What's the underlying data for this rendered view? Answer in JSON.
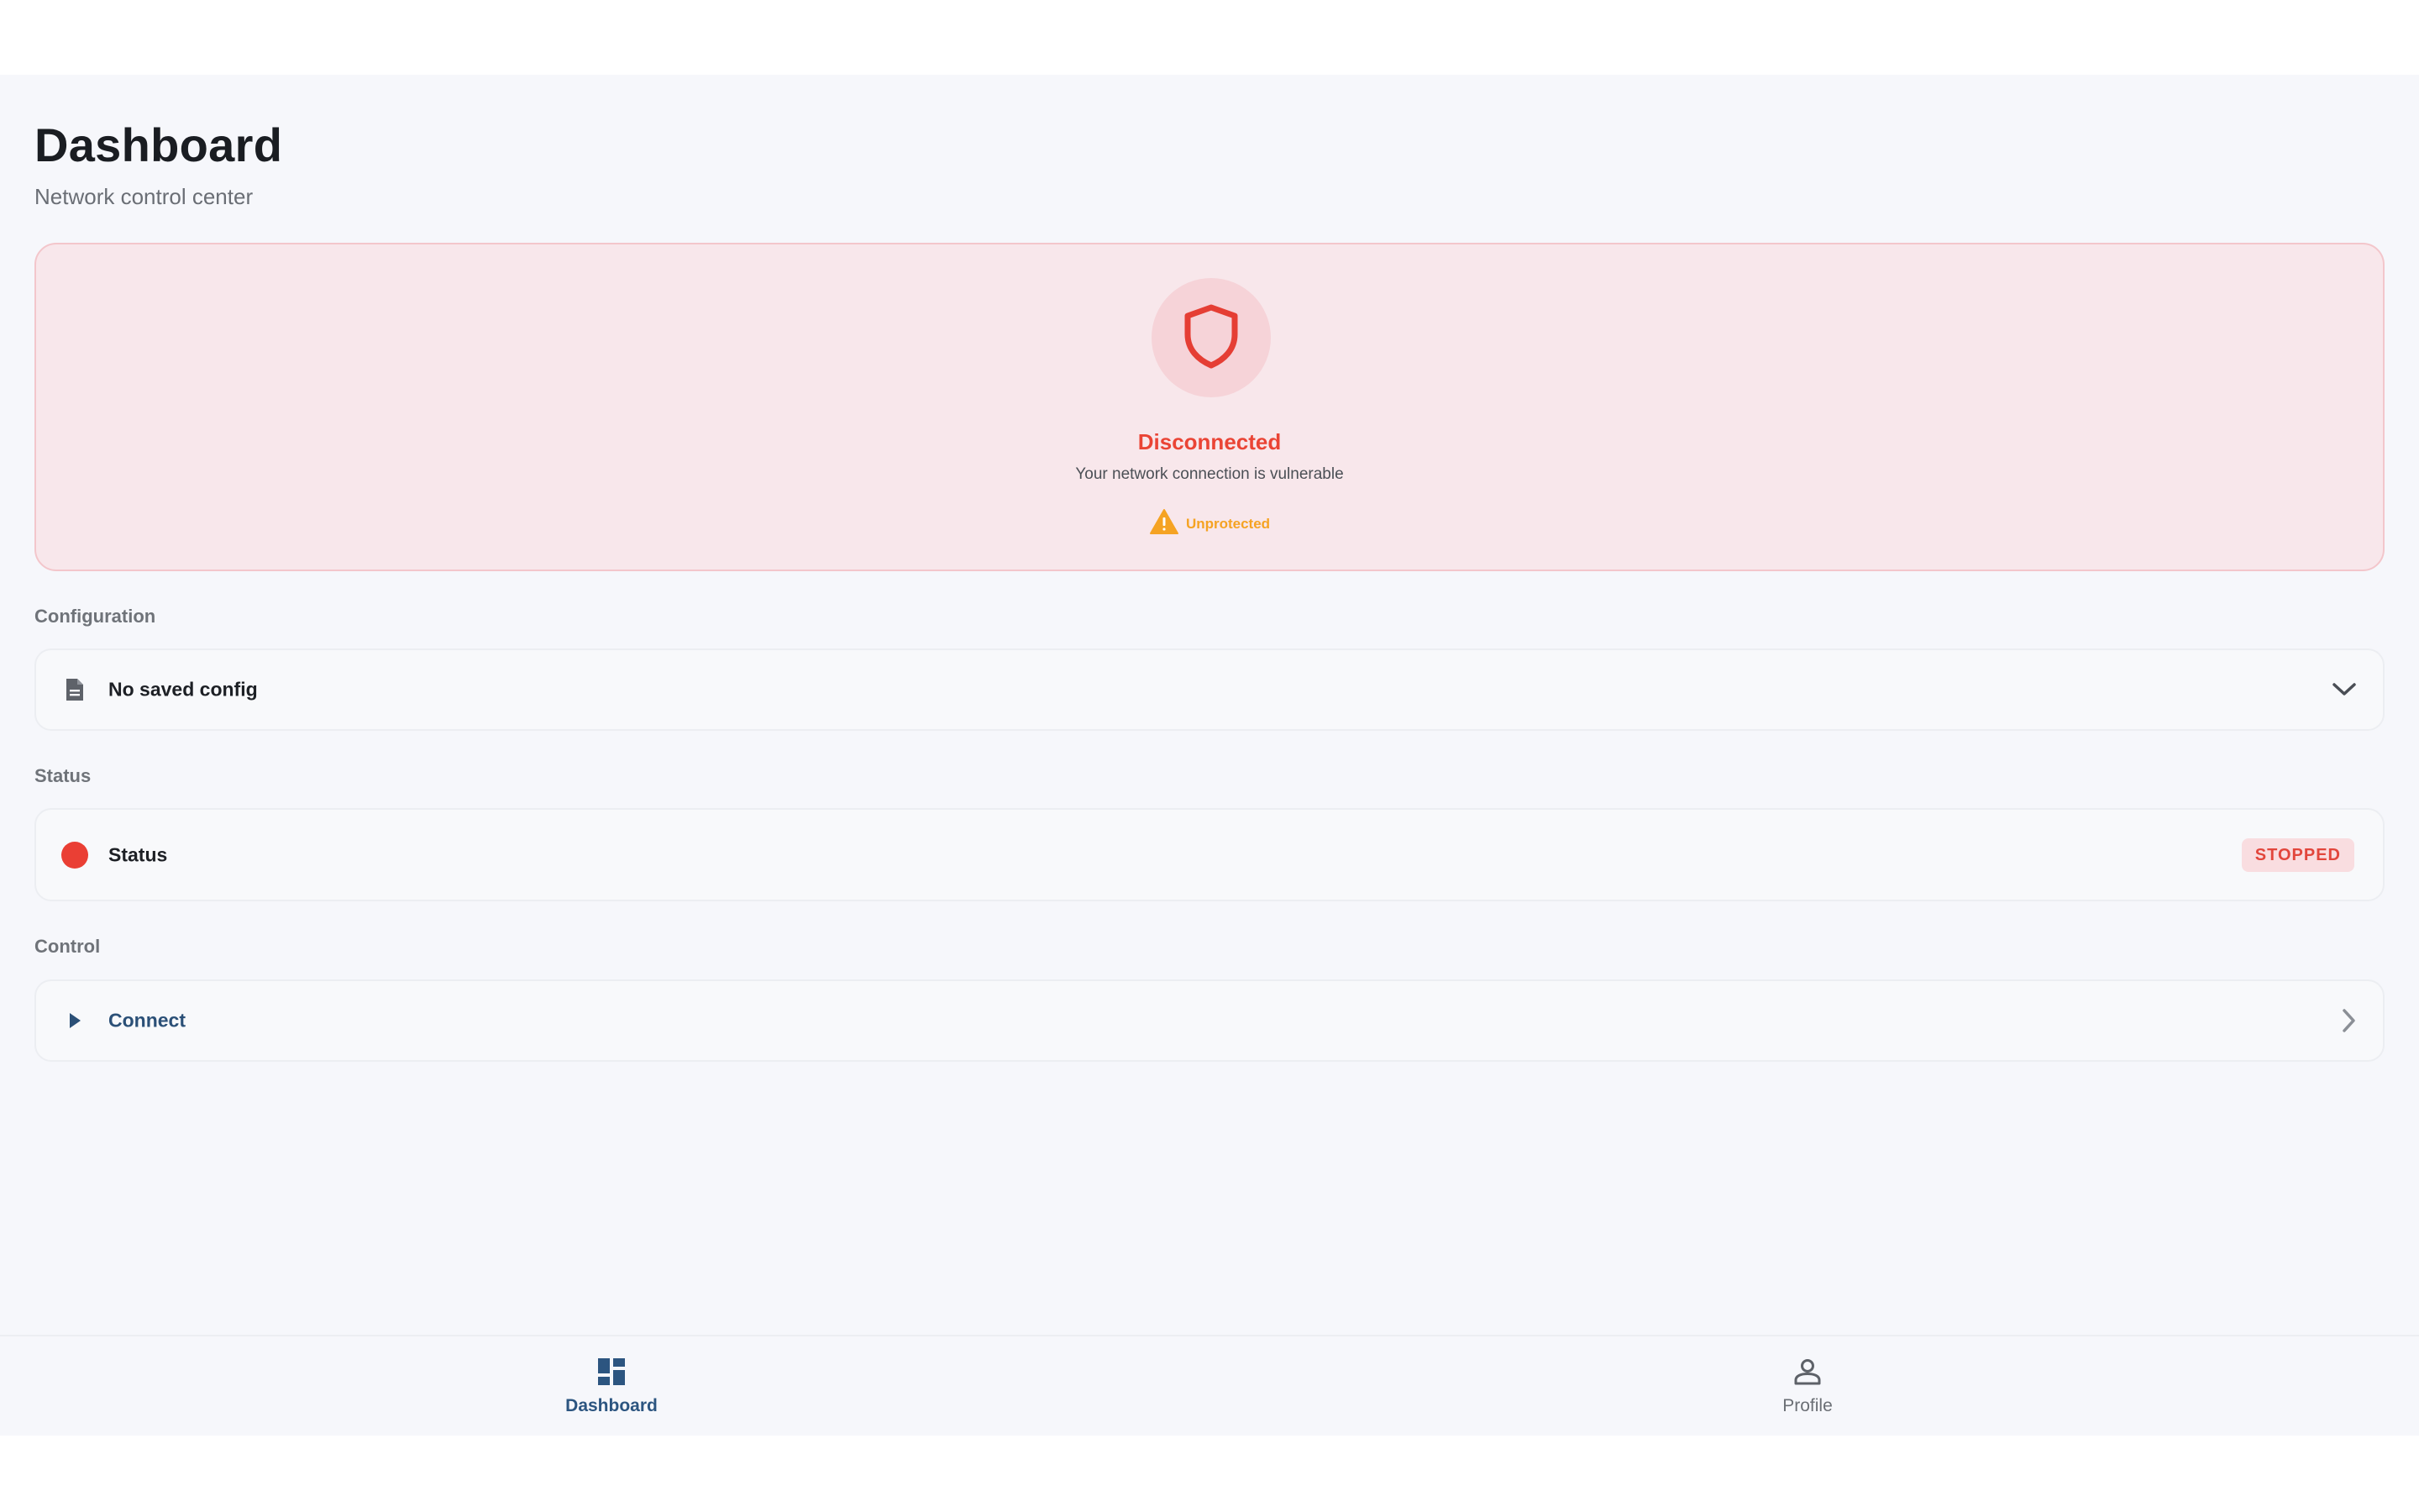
{
  "header": {
    "title": "Dashboard",
    "subtitle": "Network control center"
  },
  "status_hero": {
    "state": "Disconnected",
    "description": "Your network connection is vulnerable",
    "badge": "Unprotected",
    "state_color": "#ea4435",
    "badge_color": "#f5a323",
    "icons": [
      "shield-icon",
      "warning-icon"
    ]
  },
  "configuration": {
    "section_label": "Configuration",
    "selected_value": "No saved config",
    "icons": [
      "document-icon",
      "chevron-down-icon"
    ]
  },
  "status_section": {
    "section_label": "Status",
    "label": "Status",
    "badge": "STOPPED",
    "indicator_color": "#ea3f34"
  },
  "control": {
    "section_label": "Control",
    "action_label": "Connect",
    "icons": [
      "play-icon",
      "chevron-right-icon"
    ]
  },
  "bottom_nav": {
    "items": [
      {
        "label": "Dashboard",
        "icon": "dashboard-icon",
        "active": true
      },
      {
        "label": "Profile",
        "icon": "person-icon",
        "active": false
      }
    ],
    "active_color": "#2c5580"
  }
}
